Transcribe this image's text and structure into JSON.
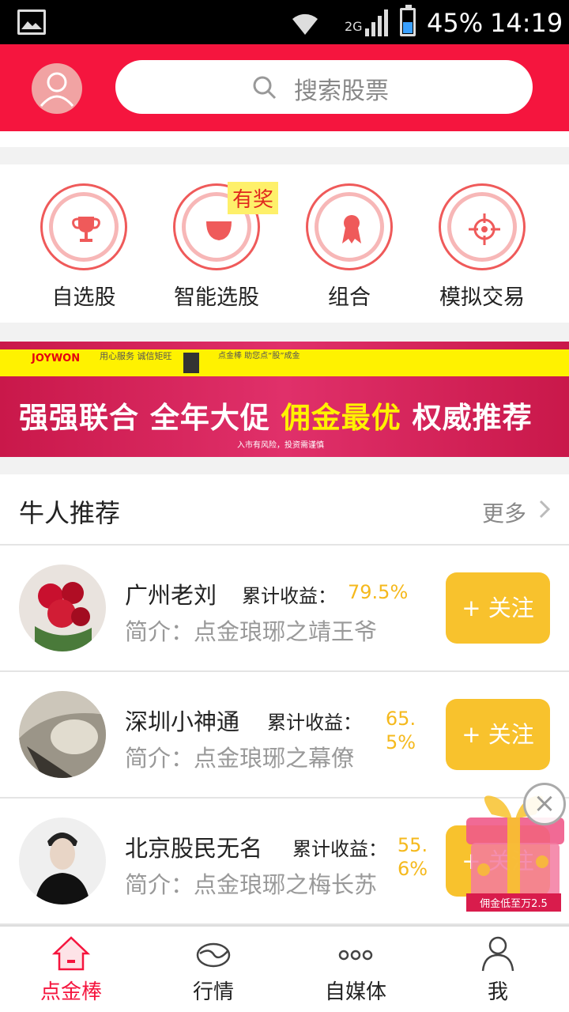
{
  "status_bar": {
    "network": "2G",
    "battery": "45%",
    "time": "14:19"
  },
  "header": {
    "search_placeholder": "搜索股票"
  },
  "quick_nav": [
    {
      "label": "自选股",
      "icon": "trophy-icon"
    },
    {
      "label": "智能选股",
      "icon": "bowl-icon",
      "badge": "有奖"
    },
    {
      "label": "组合",
      "icon": "ribbon-medal-icon"
    },
    {
      "label": "模拟交易",
      "icon": "target-icon"
    }
  ],
  "banner": {
    "brand": "JOYWON",
    "brand_slogan": "用心服务 诚信矩旺",
    "partner_slogan": "点金棒 助您点“股”成金",
    "headline_1": "强强联合",
    "headline_2": "全年大促",
    "headline_3": "佣金最优",
    "headline_4": "权威推荐",
    "risk_note": "入市有风险，投资需谨慎"
  },
  "recommend": {
    "title": "牛人推荐",
    "more": "更多",
    "gain_label": "累计收益：",
    "follow_label": "+ 关注",
    "items": [
      {
        "name": "广州老刘",
        "gain": "79.5%",
        "intro": "简介：点金琅琊之靖王爷"
      },
      {
        "name": "深圳小神通",
        "gain": "65.5%",
        "intro": "简介：点金琅琊之幕僚"
      },
      {
        "name": "北京股民无名",
        "gain": "55.6%",
        "intro": "简介：点金琅琊之梅长苏"
      }
    ]
  },
  "gift": {
    "text": "佣金低至万2.5"
  },
  "bottom_nav": [
    {
      "label": "点金棒",
      "icon": "home-icon",
      "active": true
    },
    {
      "label": "行情",
      "icon": "market-icon"
    },
    {
      "label": "自媒体",
      "icon": "more-dots-icon"
    },
    {
      "label": "我",
      "icon": "person-icon"
    }
  ],
  "colors": {
    "primary": "#f5153e",
    "accent_yellow": "#f8c22d",
    "gain": "#f5b91d"
  }
}
